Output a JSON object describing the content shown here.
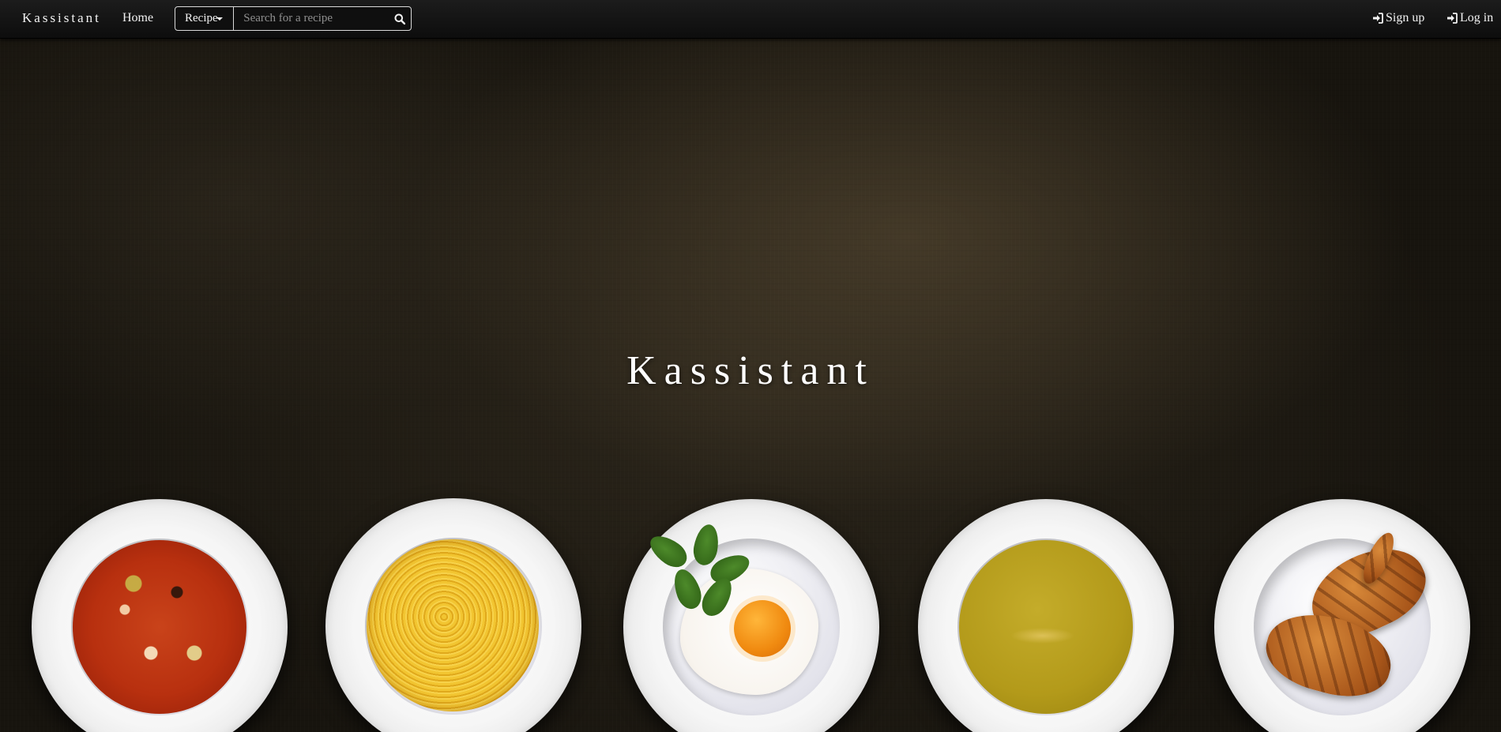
{
  "navbar": {
    "brand": "Kassistant",
    "home_label": "Home",
    "search": {
      "category_selected": "Recipe",
      "placeholder": "Search for a recipe",
      "value": ""
    },
    "signup_label": "Sign up",
    "login_label": "Log in"
  },
  "hero": {
    "title": "Kassistant"
  },
  "dishes": [
    {
      "name": "soup-plate"
    },
    {
      "name": "pasta-plate"
    },
    {
      "name": "egg-plate"
    },
    {
      "name": "cream-soup-plate"
    },
    {
      "name": "croissant-plate"
    }
  ],
  "icons": {
    "search": "search-icon",
    "signup": "sign-in-icon",
    "login": "sign-in-icon",
    "dropdown": "caret-down-icon"
  },
  "colors": {
    "navbar_bg": "#111111",
    "text": "#f2f2f2",
    "hero_bg": "#221d15"
  }
}
